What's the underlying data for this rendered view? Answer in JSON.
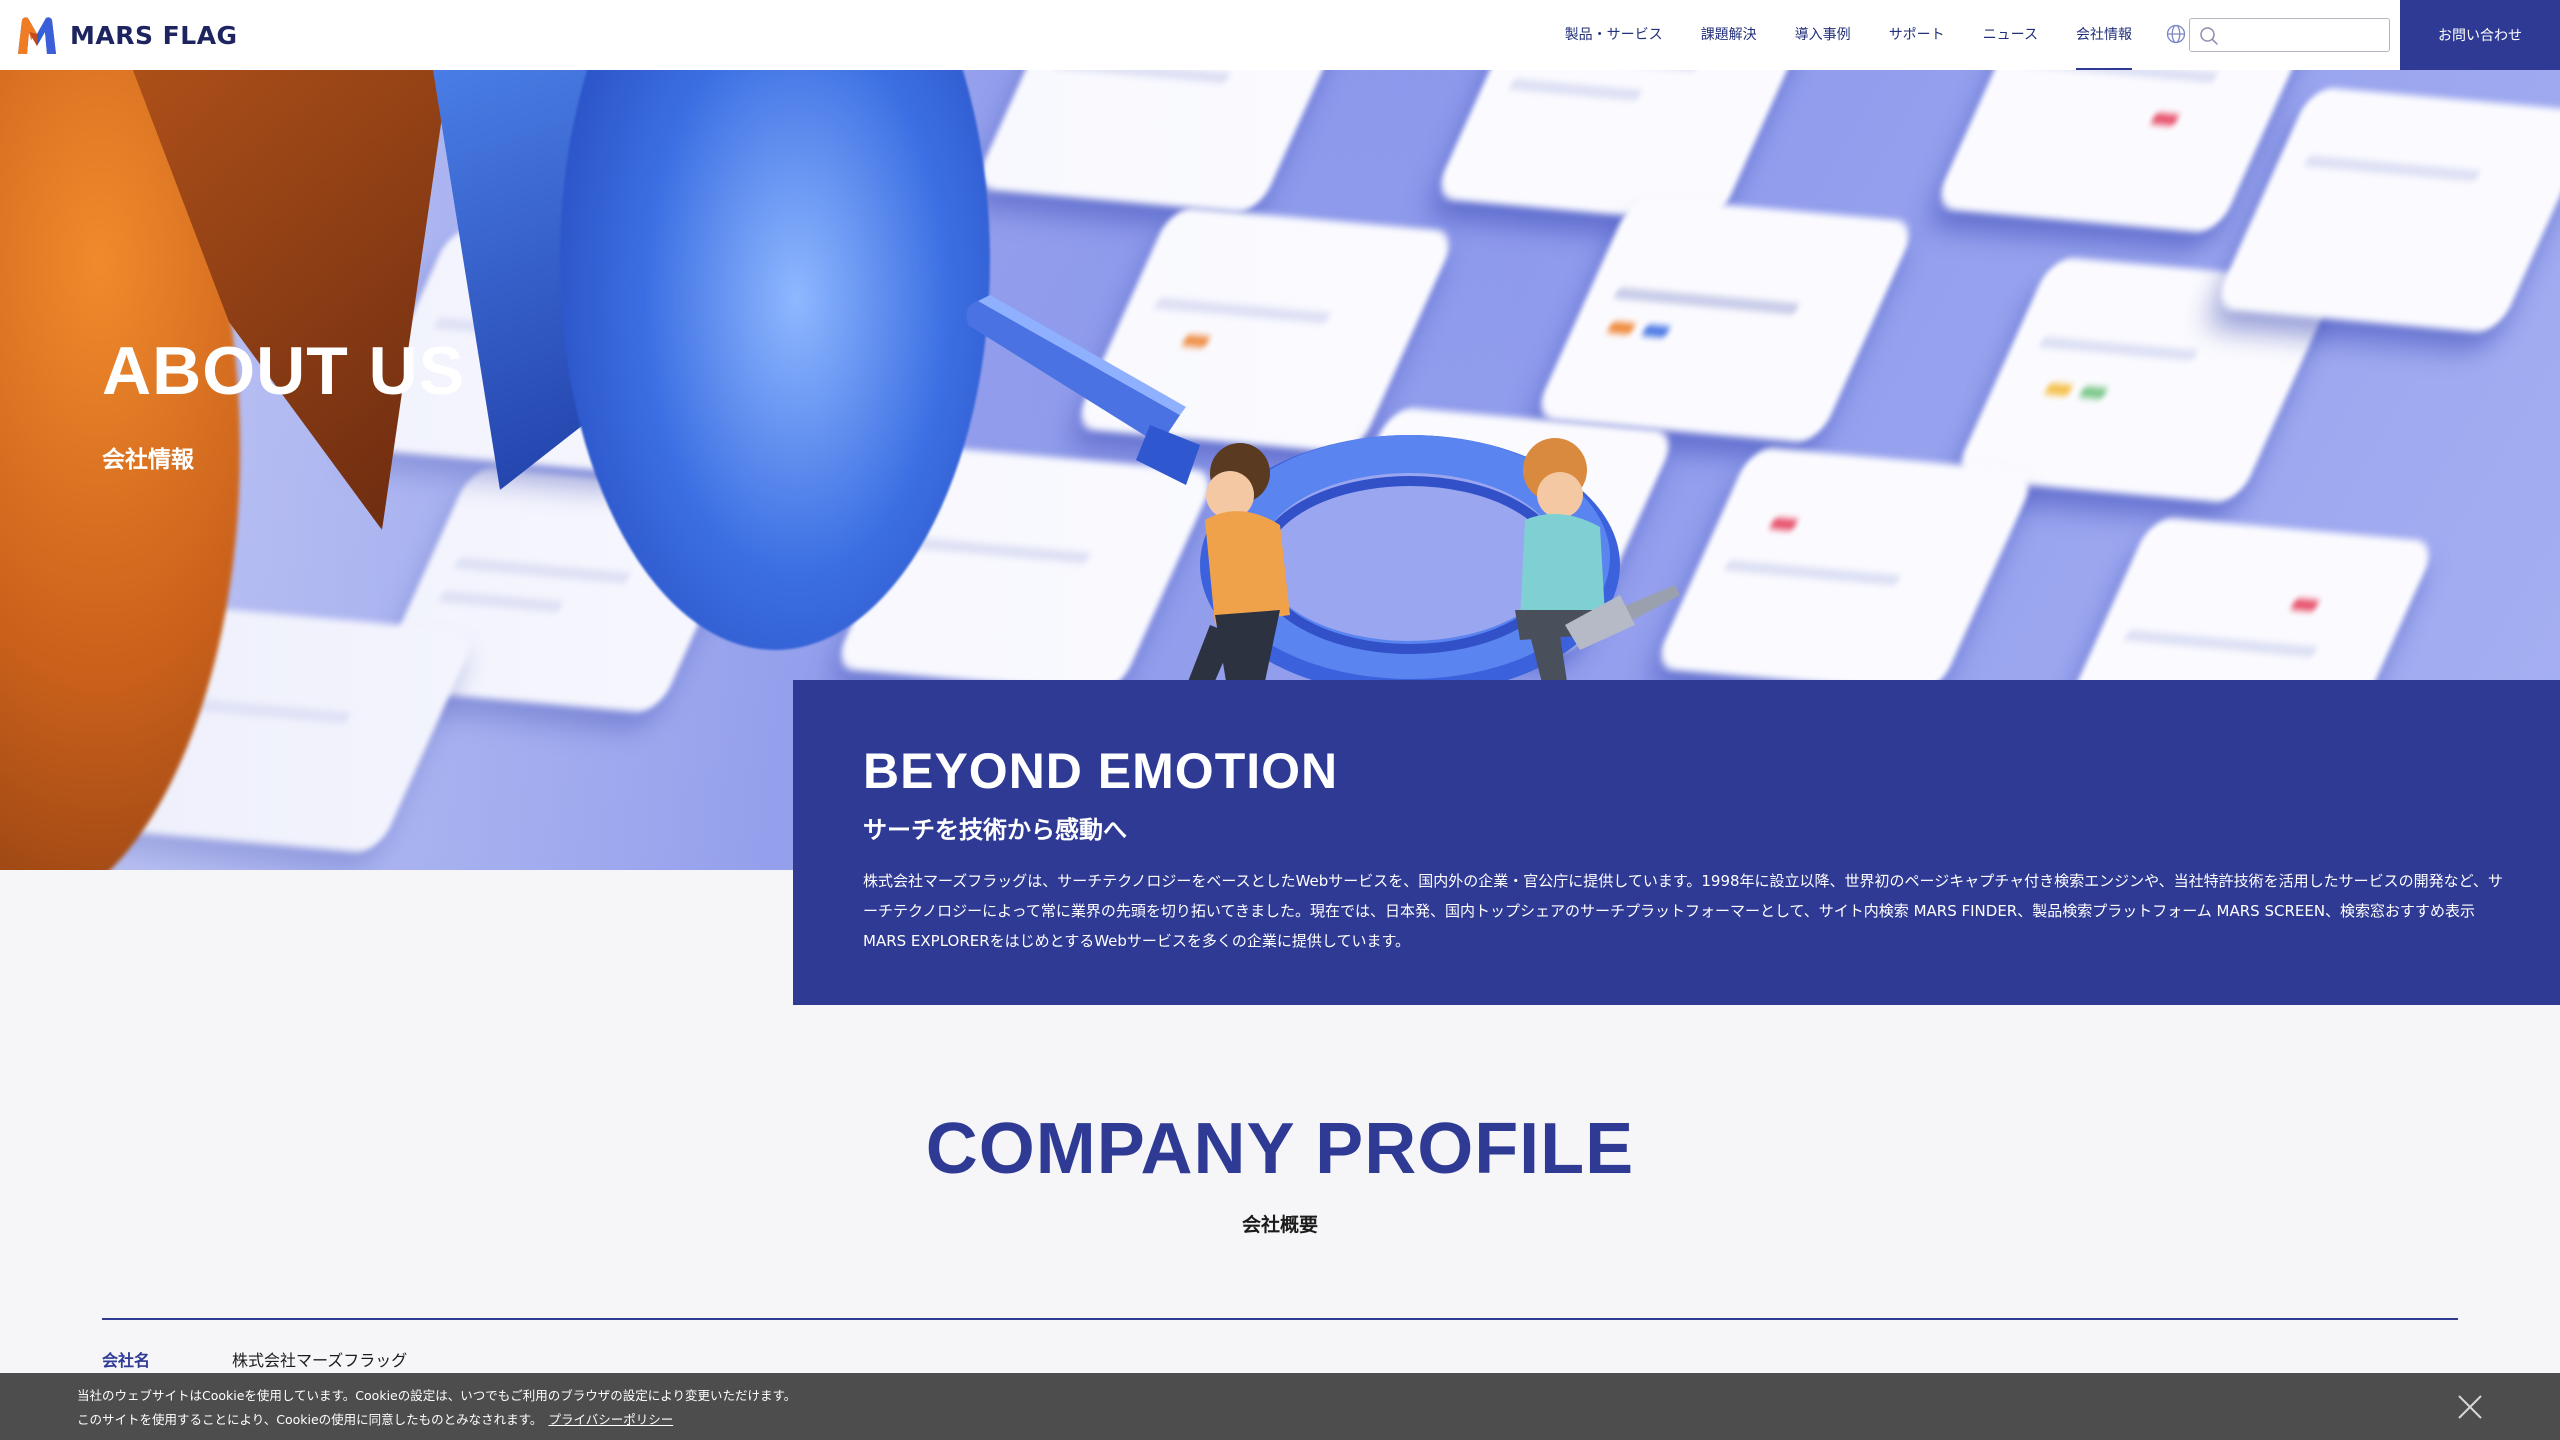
{
  "header": {
    "logo_text": "MARS FLAG",
    "nav": [
      "製品・サービス",
      "課題解決",
      "導入事例",
      "サポート",
      "ニュース",
      "会社情報"
    ],
    "active_nav_index": 5,
    "search_placeholder": "",
    "contact_label": "お問い合わせ"
  },
  "hero": {
    "title": "ABOUT US",
    "subtitle": "会社情報"
  },
  "panel": {
    "title": "BEYOND EMOTION",
    "subtitle": "サーチを技術から感動へ",
    "body": "株式会社マーズフラッグは、サーチテクノロジーをベースとしたWebサービスを、国内外の企業・官公庁に提供しています。1998年に設立以降、世界初のページキャプチャ付き検索エンジンや、当社特許技術を活用したサービスの開発など、サーチテクノロジーによって常に業界の先頭を切り拓いてきました。現在では、日本発、国内トップシェアのサーチプラットフォーマーとして、サイト内検索 MARS FINDER、製品検索プラットフォーム MARS SCREEN、検索窓おすすめ表示 MARS EXPLORERをはじめとするWebサービスを多くの企業に提供しています。"
  },
  "company_profile": {
    "title": "COMPANY PROFILE",
    "subtitle": "会社概要",
    "rows": [
      {
        "label": "会社名",
        "value": "株式会社マーズフラッグ"
      }
    ]
  },
  "cookie": {
    "line1": "当社のウェブサイトはCookieを使用しています。Cookieの設定は、いつでもご利用のブラウザの設定により変更いただけます。",
    "line2": "このサイトを使用することにより、Cookieの使用に同意したものとみなされます。",
    "link": "プライバシーポリシー"
  },
  "colors": {
    "brand_navy": "#2f3a94",
    "nav_text": "#23307a",
    "cookie_bg": "#464646"
  },
  "icons": [
    "mars-flag-logo-icon",
    "globe-icon",
    "search-icon",
    "close-icon"
  ]
}
